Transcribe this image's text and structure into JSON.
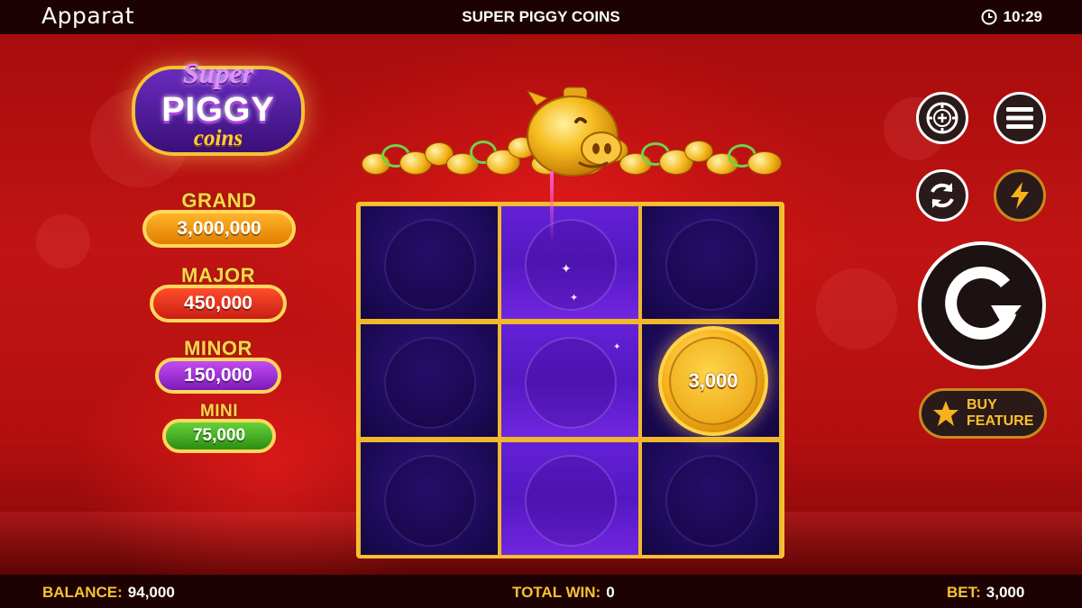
{
  "header": {
    "brand": "Apparat",
    "title": "SUPER PIGGY COINS",
    "time": "10:29"
  },
  "logo": {
    "line1": "Super",
    "line2": "PIGGY",
    "line3": "coins"
  },
  "jackpots": [
    {
      "name": "GRAND",
      "value": "3,000,000"
    },
    {
      "name": "MAJOR",
      "value": "450,000"
    },
    {
      "name": "MINOR",
      "value": "150,000"
    },
    {
      "name": "MINI",
      "value": "75,000"
    }
  ],
  "reels": {
    "coin_value": "3,000",
    "highlighted_column": 2
  },
  "controls": {
    "icons": [
      "chip-icon",
      "menu-icon",
      "autoplay-icon",
      "turbo-icon",
      "spin-icon",
      "star-icon"
    ],
    "buy_feature_label": "BUY FEATURE"
  },
  "footer": {
    "balance_label": "BALANCE:",
    "balance": "94,000",
    "total_win_label": "TOTAL WIN:",
    "total_win": "0",
    "bet_label": "BET:",
    "bet": "3,000"
  },
  "colors": {
    "accent_gold": "#f6c232",
    "bar_bg": "#1c0203",
    "grid_cell": "#1b0a55",
    "highlight_column": "#5f1fd3"
  }
}
